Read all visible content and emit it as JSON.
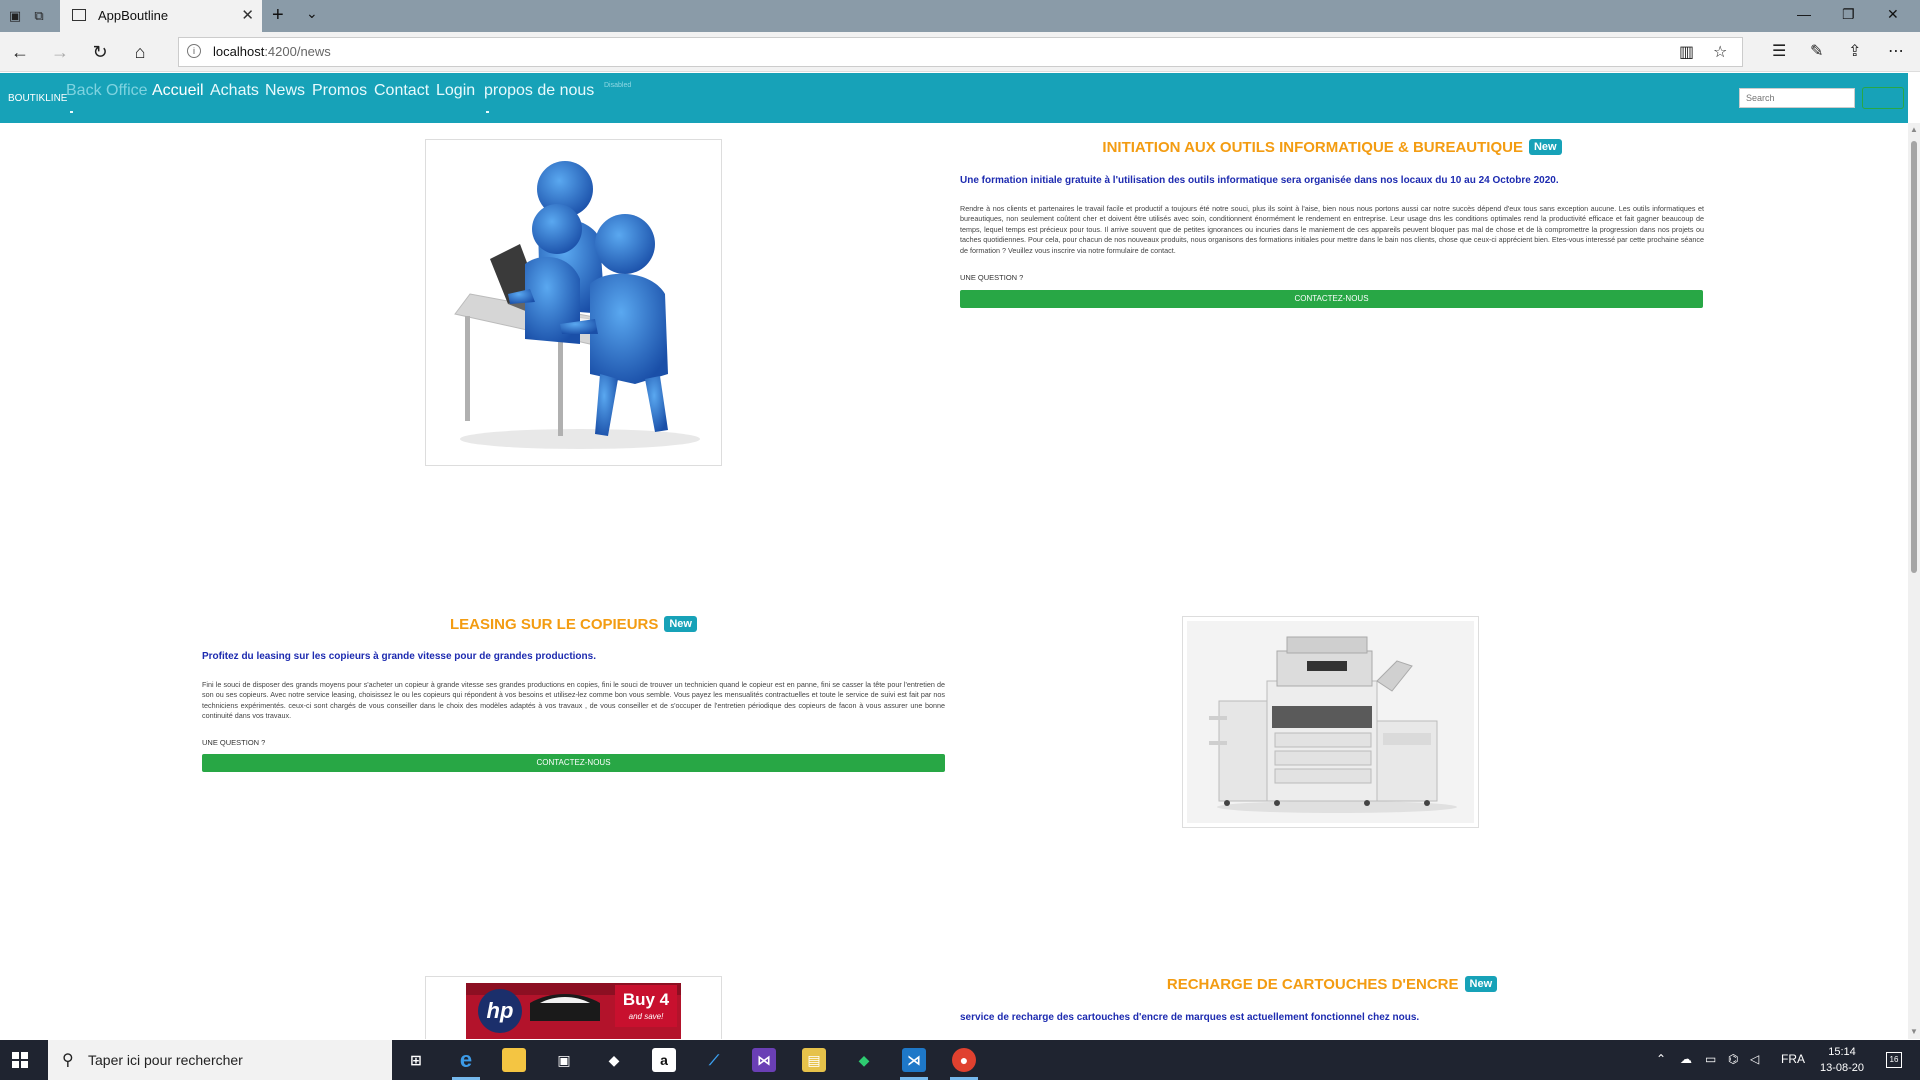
{
  "browser": {
    "tab_title": "AppBoutline",
    "url_host": "localhost",
    "url_path": ":4200/news"
  },
  "navbar": {
    "brand": "BOUTIKLINE",
    "links": [
      "Back Office",
      "Accueil",
      "Achats",
      "News",
      "Promos",
      "Contact",
      "Login",
      "propos de nous"
    ],
    "disabled_label": "Disabled",
    "search_placeholder": "Search"
  },
  "articles": [
    {
      "title": "INITIATION AUX OUTILS INFORMATIQUE & BUREAUTIQUE",
      "badge": "New",
      "lead": "Une formation initiale gratuite à l'utilisation des outils informatique sera organisée dans nos locaux du 10 au 24 Octobre 2020.",
      "body": "Rendre à nos clients et partenaires le travail facile et productif a toujours été notre souci, plus ils soint à l'aise, bien nous nous portons aussi car notre succès dépend d'eux tous sans exception aucune. Les outils informatiques et bureautiques, non seulement coûtent cher et doivent être utilisés avec soin, conditionnent énormément le rendement en entreprise. Leur usage dns les conditions optimales rend la productivité efficace et fait gagner beaucoup de temps, lequel temps est précieux pour tous. Il arrive souvent que de petites ignorances ou incuries dans le maniement de ces appareils peuvent bloquer pas mal de chose et de là compromettre la progression dans nos projets ou taches quotidiennes. Pour cela, pour chacun de nos nouveaux produits, nous organisons des formations initiales pour mettre dans le bain nos clients, chose que ceux-ci apprécient bien. Etes-vous interessé par cette prochaine séance de formation ? Veuillez vous inscrire via notre formulaire de contact.",
      "question": "UNE QUESTION ?",
      "cta": "CONTACTEZ-NOUS"
    },
    {
      "title": "LEASING SUR LE COPIEURS",
      "badge": "New",
      "lead": "Profitez du leasing sur les copieurs à grande vitesse pour de grandes productions.",
      "body": "Fini le souci de disposer des grands moyens pour s'acheter un copieur à grande vitesse ses grandes productions en copies, fini le souci de trouver un technicien quand le copieur est en panne, fini se casser la tête pour l'entretien de son ou ses copieurs. Avec notre service leasing, choisissez le ou les copieurs qui répondent à vos besoins et utilisez-lez comme bon vous semble. Vous payez les mensualités contractuelles et toute le service de suivi est fait par nos techniciens expérimentés. ceux-ci sont chargés de vous conseiller dans le choix des modèles adaptés à vos travaux , de vous conseiller et de s'occuper de l'entretien périodique des copieurs de facon à vous assurer une bonne continuité dans vos travaux.",
      "question": "UNE QUESTION ?",
      "cta": "CONTACTEZ-NOUS"
    },
    {
      "title": "RECHARGE DE CARTOUCHES D'ENCRE",
      "badge": "New",
      "lead": "service de recharge des cartouches d'encre de marques est actuellement fonctionnel chez nous."
    }
  ],
  "ink_image": {
    "brand": "hp",
    "promo_line1": "Buy 4",
    "promo_line2": "and save!"
  },
  "taskbar": {
    "search_placeholder": "Taper ici pour rechercher",
    "language": "FRA",
    "time": "15:14",
    "date": "13-08-20",
    "notifications": "16"
  },
  "colors": {
    "navbar": "#17a2b8",
    "title": "#f39c12",
    "lead": "#1d2bb0",
    "cta": "#28a745"
  }
}
